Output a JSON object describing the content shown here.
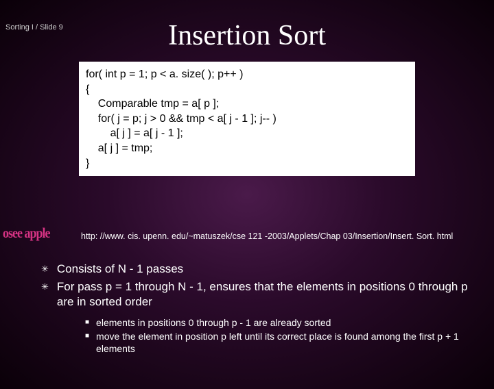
{
  "header": "Sorting I / Slide 9",
  "title": "Insertion Sort",
  "code": "for( int p = 1; p < a. size( ); p++ )\n{\n    Comparable tmp = a[ p ];\n    for( j = p; j > 0 && tmp < a[ j - 1 ]; j-- )\n        a[ j ] = a[ j - 1 ];\n    a[ j ] = tmp;\n}",
  "wordart": "osee apple",
  "url": "http: //www. cis. upenn. edu/~matuszek/cse 121 -2003/Applets/Chap 03/Insertion/Insert. Sort. html",
  "bullets": [
    "Consists of N - 1 passes",
    "For pass p = 1 through N - 1, ensures that the elements in positions 0 through p are in sorted order"
  ],
  "subbullets": [
    "elements in positions 0 through p - 1 are already sorted",
    "move the element in position p left until its correct place is found among the first p + 1 elements"
  ],
  "markers": {
    "boxstar": "✳",
    "square": "■"
  }
}
